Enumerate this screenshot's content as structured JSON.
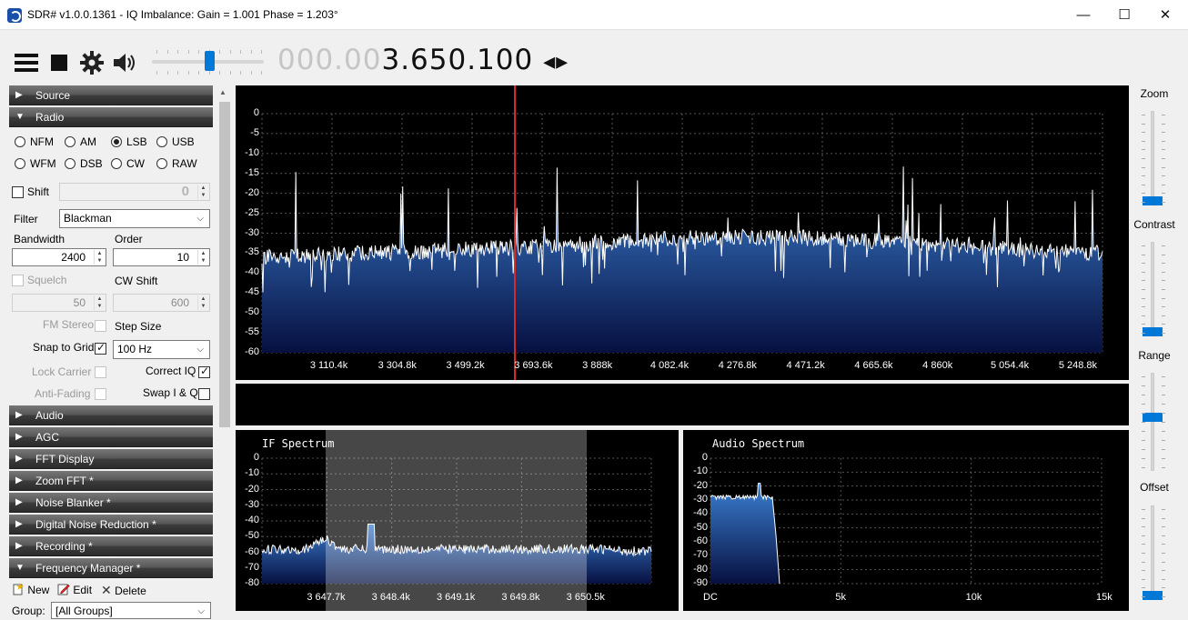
{
  "window": {
    "title": "SDR# v1.0.0.1361 - IQ Imbalance: Gain = 1.001 Phase = 1.203°",
    "minimize": "—",
    "maximize": "☐",
    "close": "✕"
  },
  "toolbar": {
    "icons": [
      "menu-icon",
      "stop-icon",
      "gear-icon",
      "speaker-icon"
    ],
    "volume_level": 0.52,
    "frequency_dim": "000.00",
    "frequency_main": "3.650.100",
    "tune_arrows": "◂▸"
  },
  "left_panel": {
    "sections_top": [
      {
        "label": "Source",
        "expanded": false
      },
      {
        "label": "Radio",
        "expanded": true
      }
    ],
    "modes_row1": [
      {
        "label": "NFM",
        "selected": false
      },
      {
        "label": "AM",
        "selected": false
      },
      {
        "label": "LSB",
        "selected": true
      },
      {
        "label": "USB",
        "selected": false
      }
    ],
    "modes_row2": [
      {
        "label": "WFM",
        "selected": false
      },
      {
        "label": "DSB",
        "selected": false
      },
      {
        "label": "CW",
        "selected": false
      },
      {
        "label": "RAW",
        "selected": false
      }
    ],
    "shift_label": "Shift",
    "shift_value": "0",
    "filter_label": "Filter",
    "filter_value": "Blackman",
    "bandwidth_label": "Bandwidth",
    "bandwidth_value": "2400",
    "order_label": "Order",
    "order_value": "10",
    "squelch_label": "Squelch",
    "squelch_value": "50",
    "cw_shift_label": "CW Shift",
    "cw_shift_value": "600",
    "fm_stereo_label": "FM Stereo",
    "step_size_label": "Step Size",
    "snap_label": "Snap to Grid",
    "step_value": "100 Hz",
    "lock_carrier_label": "Lock Carrier",
    "correct_iq_label": "Correct IQ",
    "anti_fading_label": "Anti-Fading",
    "swap_iq_label": "Swap I & Q",
    "sections_bottom": [
      {
        "label": "Audio",
        "expanded": false
      },
      {
        "label": "AGC",
        "expanded": false
      },
      {
        "label": "FFT Display",
        "expanded": false
      },
      {
        "label": "Zoom FFT *",
        "expanded": false
      },
      {
        "label": "Noise Blanker *",
        "expanded": false
      },
      {
        "label": "Digital Noise Reduction *",
        "expanded": false
      },
      {
        "label": "Recording *",
        "expanded": false
      },
      {
        "label": "Frequency Manager *",
        "expanded": true
      }
    ],
    "fm_new": "New",
    "fm_edit": "Edit",
    "fm_delete": "Delete",
    "group_label": "Group:",
    "group_value": "[All Groups]"
  },
  "main_spectrum": {
    "y_ticks": [
      "0",
      "-5",
      "-10",
      "-15",
      "-20",
      "-25",
      "-30",
      "-35",
      "-40",
      "-45",
      "-50",
      "-55",
      "-60"
    ],
    "x_ticks": [
      "3 110.4k",
      "3 304.8k",
      "3 499.2k",
      "3 693.6k",
      "3 888k",
      "4 082.4k",
      "4 276.8k",
      "4 471.2k",
      "4 665.6k",
      "4 860k",
      "5 054.4k",
      "5 248.8k"
    ],
    "y_range": [
      -60,
      0
    ],
    "tuned_marker_color": "#d42a2a"
  },
  "if_spectrum": {
    "title": "IF Spectrum",
    "y_ticks": [
      "0",
      "-10",
      "-20",
      "-30",
      "-40",
      "-50",
      "-60",
      "-70",
      "-80"
    ],
    "x_ticks": [
      "3 647.7k",
      "3 648.4k",
      "3 649.1k",
      "3 649.8k",
      "3 650.5k"
    ],
    "y_range": [
      -80,
      0
    ]
  },
  "audio_spectrum": {
    "title": "Audio Spectrum",
    "y_ticks": [
      "0",
      "-10",
      "-20",
      "-30",
      "-40",
      "-50",
      "-60",
      "-70",
      "-80",
      "-90"
    ],
    "x_ticks": [
      "DC",
      "5k",
      "10k",
      "15k"
    ],
    "y_range": [
      -90,
      0
    ]
  },
  "right_panel": {
    "zoom_label": "Zoom",
    "contrast_label": "Contrast",
    "range_label": "Range",
    "offset_label": "Offset",
    "zoom_level": 0.0,
    "contrast_level": 0.0,
    "range_level": 0.55,
    "offset_level": 0.0
  },
  "colors": {
    "spectrum_fill_top": "#3b7fd1",
    "spectrum_fill_bottom": "#071040",
    "trace": "#ffffff",
    "accent": "#0078d7"
  }
}
